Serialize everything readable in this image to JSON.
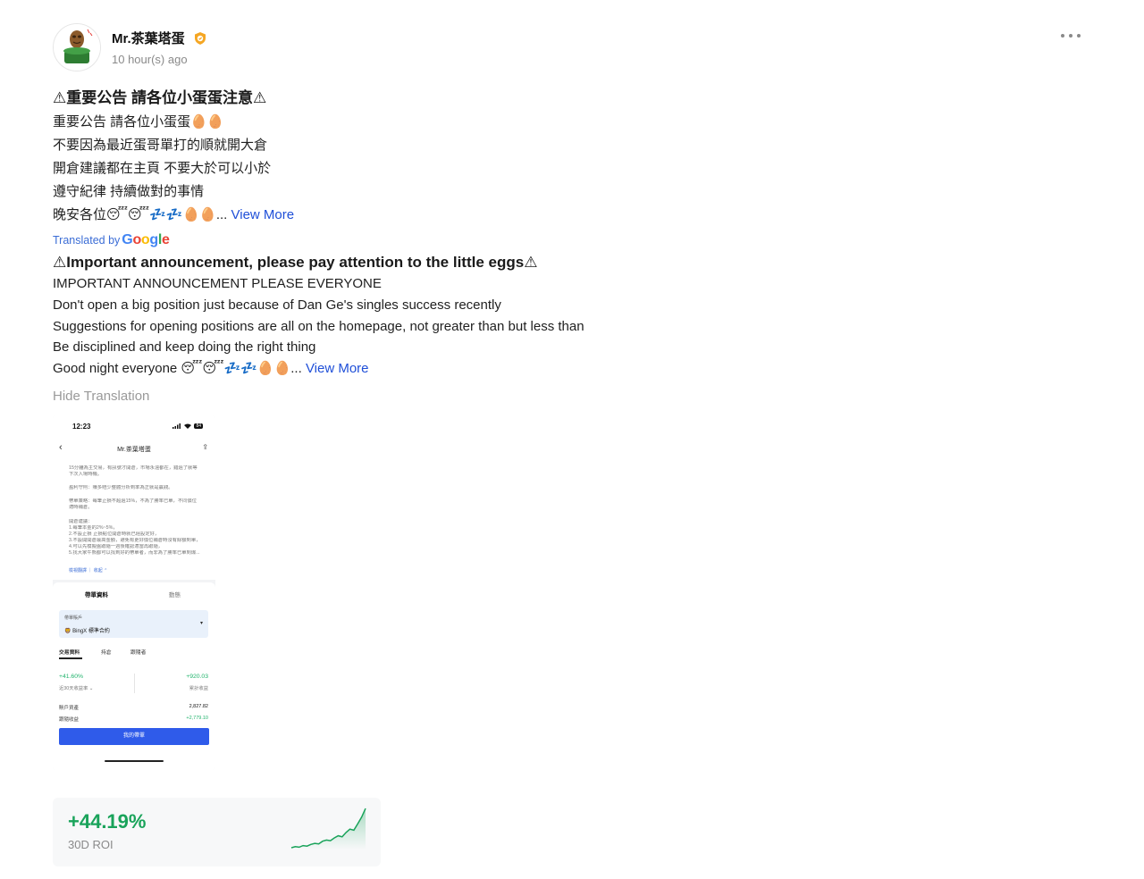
{
  "author": {
    "name": "Mr.茶葉塔蛋",
    "time": "10 hour(s) ago",
    "verified_icon": "verified-badge-icon",
    "avatar_icon": "tea-egg-avatar"
  },
  "post": {
    "original": {
      "title": "⚠重要公告 請各位小蛋蛋注意⚠",
      "lines": [
        "重要公告 請各位小蛋蛋🥚🥚",
        "不要因為最近蛋哥單打的順就開大倉",
        "開倉建議都在主頁 不要大於可以小於",
        "遵守紀律 持續做對的事情",
        "晚安各位😴😴💤💤🥚🥚..."
      ],
      "view_more": "View More"
    },
    "translated_by": "Translated by",
    "google": "Google",
    "translation": {
      "title": "⚠Important announcement, please pay attention to the little eggs⚠",
      "lines": [
        "IMPORTANT ANNOUNCEMENT PLEASE EVERYONE",
        "Don't open a big position just because of Dan Ge's singles success recently",
        "Suggestions for opening positions are all on the homepage, not greater than but less than",
        "Be disciplined and keep doing the right thing",
        "Good night everyone 😴😴💤💤🥚🥚..."
      ],
      "view_more": "View More"
    },
    "hide_translation": "Hide Translation"
  },
  "screenshot": {
    "status_time": "12:23",
    "battery": "84",
    "title": "Mr.茶葉塔蛋",
    "paragraphs": [
      "15分鐘為主交易，有訊號才開倉，市場永遠都在，錯過了就等",
      "下次入場時機。",
      "盈利守則：賺多賠少整體分析到率為正就是贏錢。",
      "帶單策略：每筆止損不超過15%，不為了勝率已單，不同價位",
      "適時補倉。",
      "開倉建議：",
      "1.每筆本金的2%~5%，",
      "2.不設止損 止損點位開倉時就已經設定好，",
      "3.不設開開倉最高金額，避免有更好價位補倉時沒有餘額到單，",
      "4.可以先模擬盤跟隨一週後確認適當再跟隨，",
      "5.找大家牛熊都可以找到好的帶單者，而非為了勝率已單到爆..."
    ],
    "links": "檢視翻譯 ｜ 收起 ⌃",
    "tab_active": "帶單資料",
    "tab_other": "動態",
    "account_label": "帶單賬戶",
    "account_value": "BingX 標準合約",
    "subtabs": [
      "交易資料",
      "持倉",
      "跟隨者"
    ],
    "roi_30d": "+41.60%",
    "roi_30d_label": "近30天收益率 ⌄",
    "total_pnl": "+920.03",
    "total_pnl_label": "累計收益",
    "assets_label": "賬戶資產",
    "assets_value": "2,827.82",
    "follow_label": "跟隨收益",
    "follow_value": "+2,779.10",
    "button": "我的帶單"
  },
  "roi_card": {
    "value": "+44.19%",
    "label": "30D ROI",
    "color": "#19a35a",
    "sparkline": [
      2,
      3,
      2.5,
      4,
      3.5,
      5,
      6,
      5.5,
      8,
      9,
      8.5,
      11,
      13,
      12,
      16,
      19,
      18,
      24,
      30,
      38
    ]
  }
}
